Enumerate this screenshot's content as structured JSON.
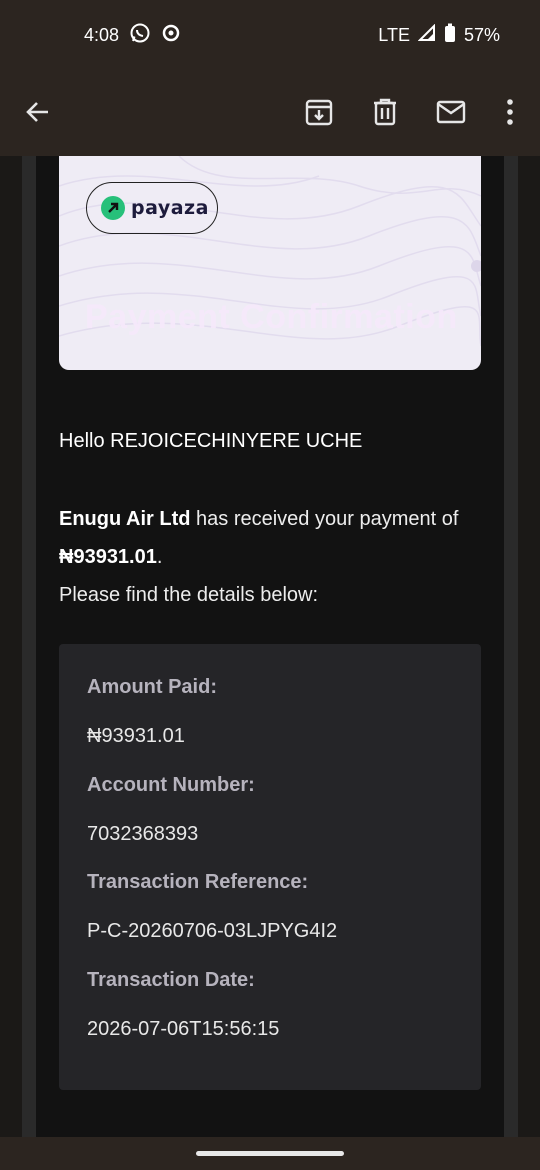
{
  "status_bar": {
    "time": "4:08",
    "network": "LTE",
    "battery": "57%",
    "icons": [
      "whatsapp-icon",
      "sync-icon",
      "signal-icon",
      "battery-icon"
    ]
  },
  "toolbar": {
    "icons": [
      "back-arrow-icon",
      "archive-icon",
      "delete-icon",
      "mark-unread-icon",
      "more-vert-icon"
    ]
  },
  "email": {
    "banner": {
      "logo_text": "payaza",
      "heading": "Payment Confirmation"
    },
    "greeting": "Hello REJOICECHINYERE UCHE",
    "merchant": "Enugu Air Ltd",
    "message_mid": " has received your payment of ",
    "amount": "₦93931.01",
    "message_end": ".",
    "instruction": "Please find the details below:",
    "details": {
      "amount_label": "Amount Paid:",
      "amount_value": "₦93931.01",
      "account_label": "Account Number:",
      "account_value": "7032368393",
      "reference_label": "Transaction Reference:",
      "reference_value": "P-C-20260706-03LJPYG4I2",
      "date_label": "Transaction Date:",
      "date_value": "2026-07-06T15:56:15"
    }
  },
  "colors": {
    "accent_green": "#27c07a",
    "banner_bg": "#efecf5",
    "toolbar_bg": "#2c2520",
    "email_bg": "#121212"
  }
}
